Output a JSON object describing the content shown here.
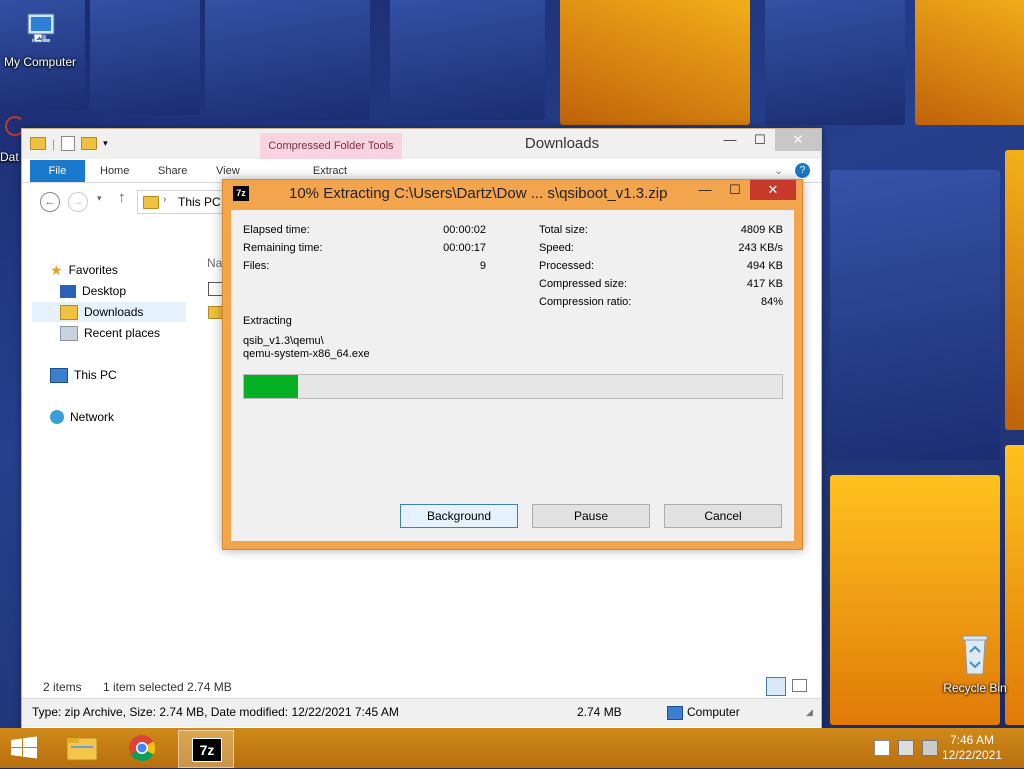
{
  "desktop": {
    "icons": {
      "my_computer": "My Computer",
      "partial_left": "Dat",
      "recycle_bin": "Recycle Bin"
    }
  },
  "explorer": {
    "title": "Downloads",
    "context_tab": "Compressed Folder Tools",
    "ribbon_tabs": [
      "File",
      "Home",
      "Share",
      "View"
    ],
    "context_subtab": "Extract",
    "address": "This PC",
    "nav": {
      "favorites": "Favorites",
      "desktop": "Desktop",
      "downloads": "Downloads",
      "recent_places": "Recent places",
      "this_pc": "This PC",
      "network": "Network"
    },
    "column_header": "Na",
    "status": {
      "items": "2 items",
      "selected": "1 item selected  2.74 MB"
    },
    "details": {
      "type_info": "Type: zip Archive, Size: 2.74 MB, Date modified: 12/22/2021 7:45 AM",
      "size": "2.74 MB",
      "location": "Computer"
    }
  },
  "dialog": {
    "title": "10% Extracting C:\\Users\\Dartz\\Dow ... s\\qsiboot_v1.3.zip",
    "app_icon": "7z",
    "stats_left": {
      "elapsed_label": "Elapsed time:",
      "elapsed_value": "00:00:02",
      "remaining_label": "Remaining time:",
      "remaining_value": "00:00:17",
      "files_label": "Files:",
      "files_value": "9"
    },
    "stats_right": {
      "total_label": "Total size:",
      "total_value": "4809 KB",
      "speed_label": "Speed:",
      "speed_value": "243 KB/s",
      "processed_label": "Processed:",
      "processed_value": "494 KB",
      "compressed_label": "Compressed size:",
      "compressed_value": "417 KB",
      "ratio_label": "Compression ratio:",
      "ratio_value": "84%"
    },
    "extracting_label": "Extracting",
    "current_path": "qsib_v1.3\\qemu\\",
    "current_file": "qemu-system-x86_64.exe",
    "progress_fraction": 0.1,
    "buttons": {
      "background": "Background",
      "pause": "Pause",
      "cancel": "Cancel"
    }
  },
  "taskbar": {
    "time": "7:46 AM",
    "date": "12/22/2021",
    "active_app_label": "7z"
  },
  "colors": {
    "progress": "#06b025",
    "file_tab": "#1979ca",
    "dialog_frame": "#f3a54d"
  }
}
